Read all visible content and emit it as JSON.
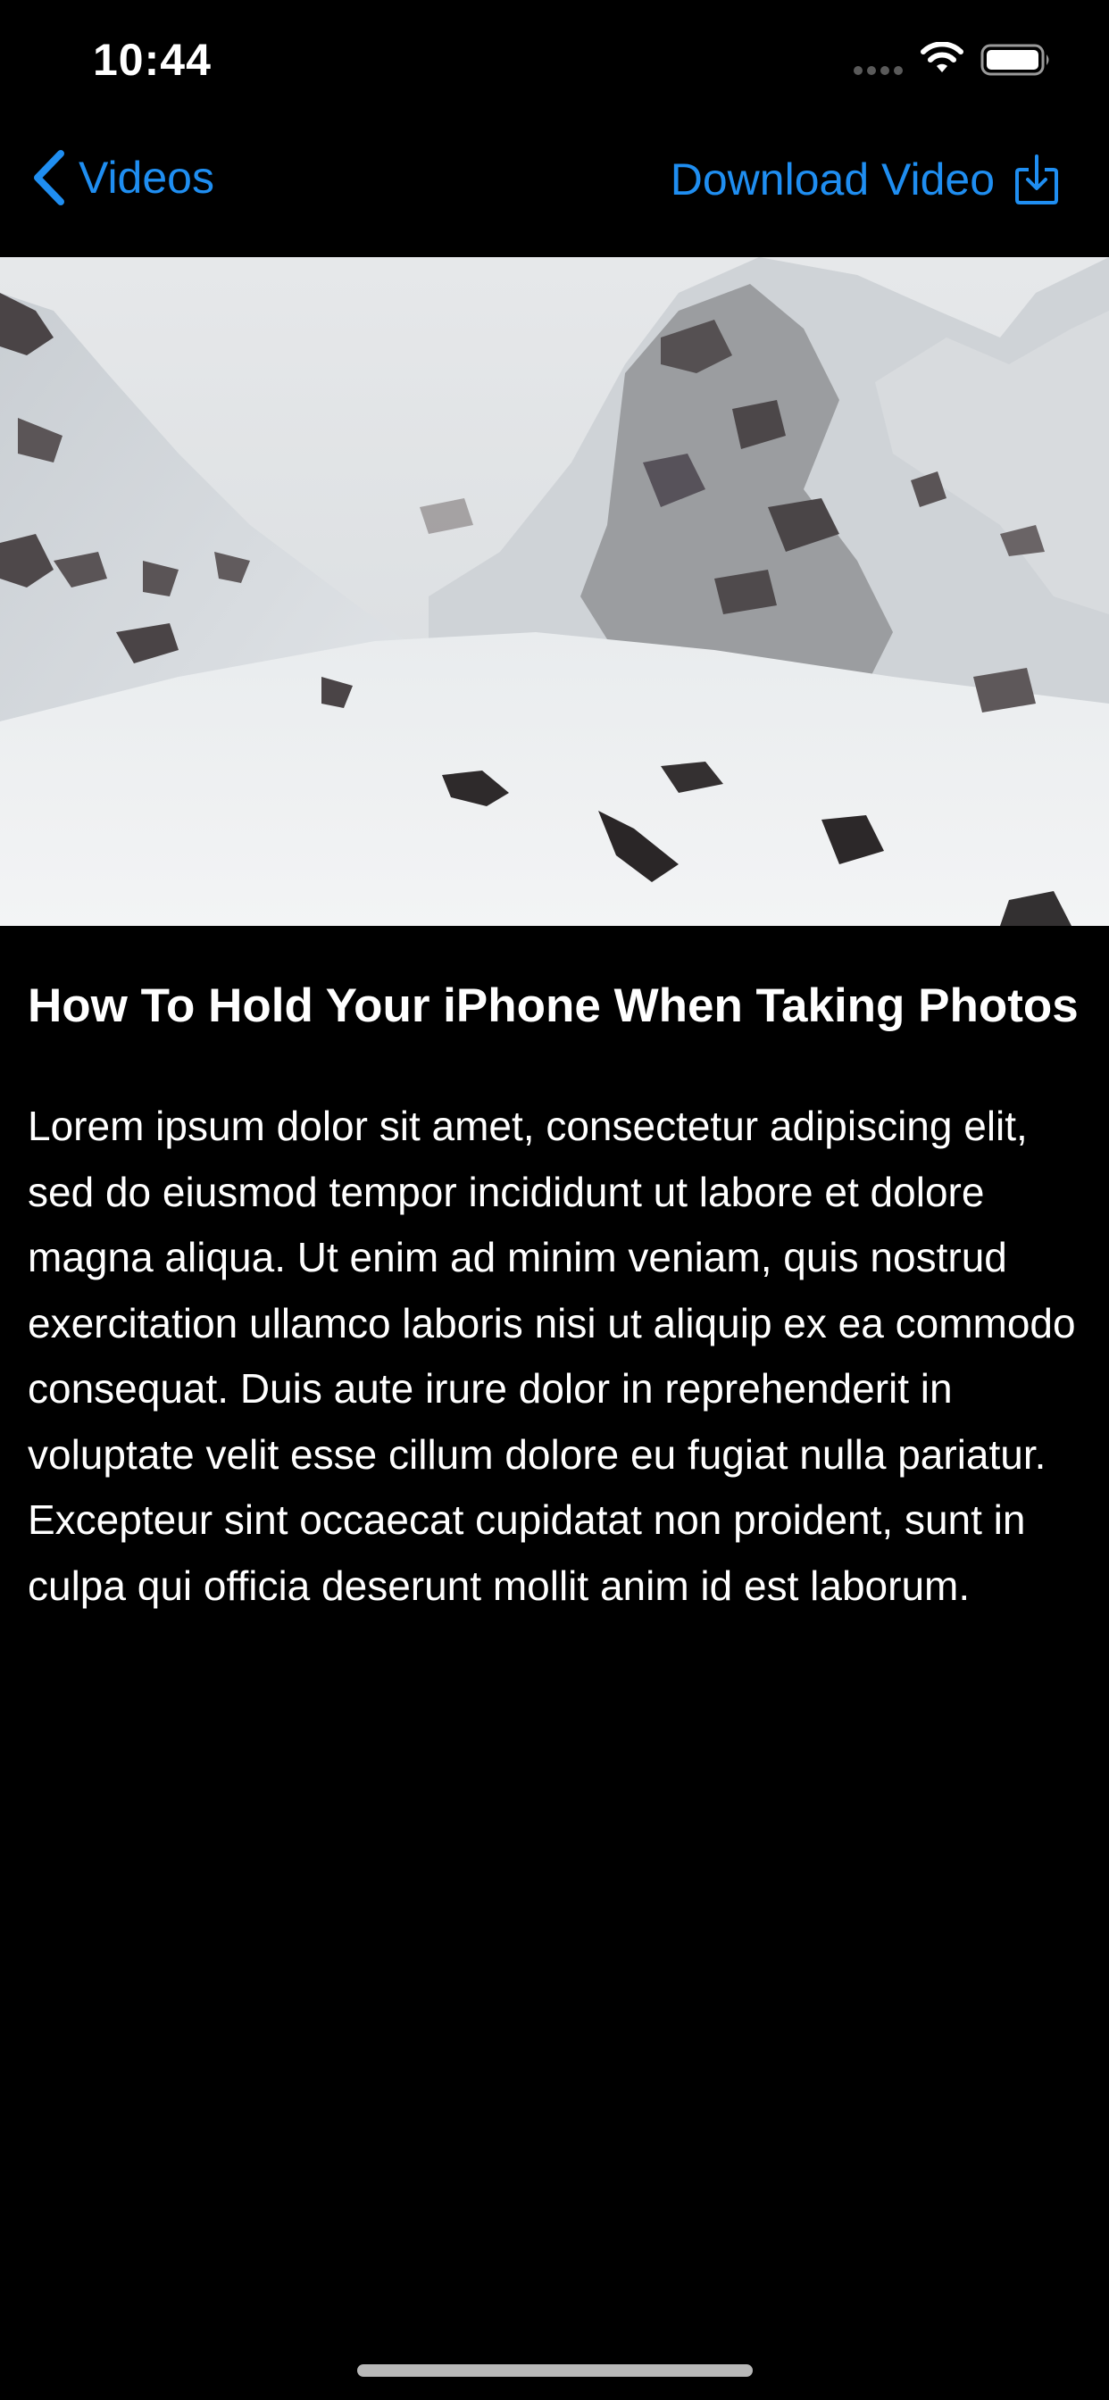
{
  "status_bar": {
    "time": "10:44"
  },
  "nav": {
    "back_label": "Videos",
    "download_label": "Download Video"
  },
  "article": {
    "title": "How To Hold Your iPhone When Taking Photos",
    "body": "Lorem ipsum dolor sit amet, consectetur adipiscing elit, sed do eiusmod tempor incididunt ut labore et dolore magna aliqua. Ut enim ad minim veniam, quis nostrud exercitation ullamco laboris nisi ut aliquip ex ea commodo consequat. Duis aute irure dolor in reprehenderit in voluptate velit esse cillum dolore eu fugiat nulla pariatur. Excepteur sint occaecat cupidatat non proident, sunt in culpa qui officia deserunt mollit anim id est laborum."
  },
  "colors": {
    "background": "#000000",
    "accent": "#1f8ef1",
    "text": "#ffffff"
  },
  "icons": {
    "back": "chevron-left-icon",
    "download": "download-icon",
    "signal": "cellular-signal-icon",
    "wifi": "wifi-icon",
    "battery": "battery-icon"
  }
}
